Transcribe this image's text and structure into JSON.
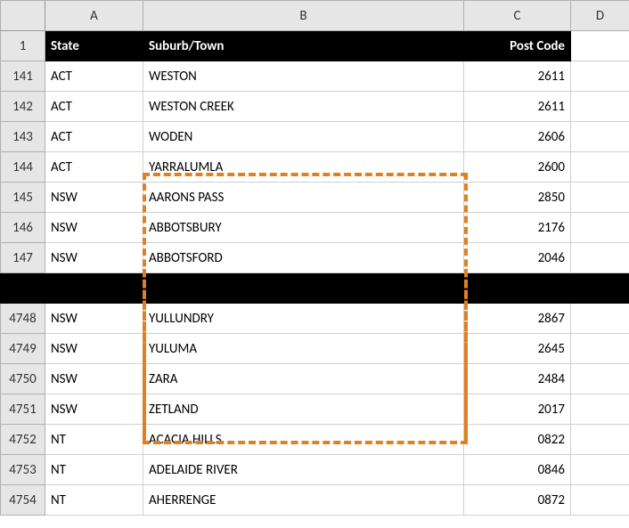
{
  "columns": {
    "A": "A",
    "B": "B",
    "C": "C",
    "D": "D"
  },
  "header_row": {
    "num": "1",
    "state": "State",
    "suburb": "Suburb/Town",
    "postcode": "Post Code"
  },
  "rows_top": [
    {
      "num": "141",
      "state": "ACT",
      "suburb": "WESTON",
      "postcode": "2611"
    },
    {
      "num": "142",
      "state": "ACT",
      "suburb": "WESTON CREEK",
      "postcode": "2611"
    },
    {
      "num": "143",
      "state": "ACT",
      "suburb": "WODEN",
      "postcode": "2606"
    },
    {
      "num": "144",
      "state": "ACT",
      "suburb": "YARRALUMLA",
      "postcode": "2600"
    },
    {
      "num": "145",
      "state": "NSW",
      "suburb": "AARONS PASS",
      "postcode": "2850"
    },
    {
      "num": "146",
      "state": "NSW",
      "suburb": "ABBOTSBURY",
      "postcode": "2176"
    },
    {
      "num": "147",
      "state": "NSW",
      "suburb": "ABBOTSFORD",
      "postcode": "2046"
    }
  ],
  "rows_bottom": [
    {
      "num": "4748",
      "state": "NSW",
      "suburb": "YULLUNDRY",
      "postcode": "2867"
    },
    {
      "num": "4749",
      "state": "NSW",
      "suburb": "YULUMA",
      "postcode": "2645"
    },
    {
      "num": "4750",
      "state": "NSW",
      "suburb": "ZARA",
      "postcode": "2484"
    },
    {
      "num": "4751",
      "state": "NSW",
      "suburb": "ZETLAND",
      "postcode": "2017"
    },
    {
      "num": "4752",
      "state": "NT",
      "suburb": "ACACIA HILLS",
      "postcode": "0822"
    },
    {
      "num": "4753",
      "state": "NT",
      "suburb": "ADELAIDE RIVER",
      "postcode": "0846"
    },
    {
      "num": "4754",
      "state": "NT",
      "suburb": "AHERRENGE",
      "postcode": "0872"
    }
  ]
}
